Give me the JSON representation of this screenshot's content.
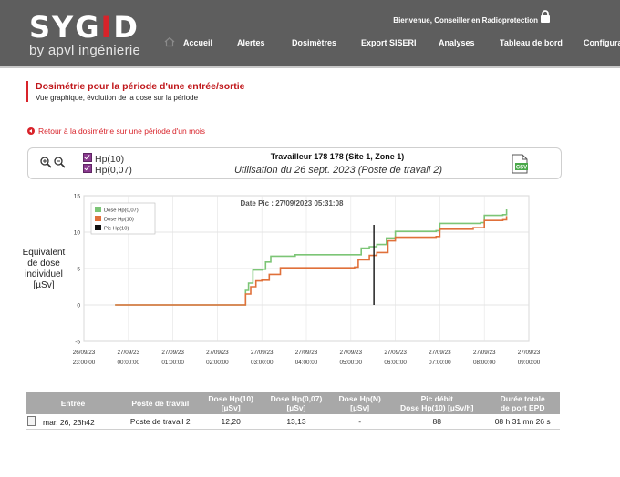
{
  "header": {
    "logo_main_left": "SYG",
    "logo_main_red": "I",
    "logo_main_right": "D",
    "logo_sub": "by apvl ingénierie",
    "welcome": "Bienvenue, Conseiller en Radioprotection",
    "nav": [
      "Accueil",
      "Alertes",
      "Dosimètres",
      "Export SISERI",
      "Analyses",
      "Tableau de bord",
      "Configurati"
    ]
  },
  "page": {
    "title": "Dosimétrie pour la période d'une entrée/sortie",
    "subtitle": "Vue graphique, évolution de la dose sur la période",
    "back_link": "Retour à la dosimétrie sur une période d'un mois"
  },
  "toolbar": {
    "legend": [
      "Hp(10)",
      "Hp(0,07)"
    ],
    "worker": "Travailleur 178 178 (Site 1, Zone 1)",
    "usage": "Utilisation du 26 sept. 2023 (Poste de travail 2)",
    "csv_label": "CSV"
  },
  "chart_data": {
    "type": "line",
    "title": "Date Pic : 27/09/2023 05:31:08",
    "ylabel": [
      "Equivalent",
      "de dose",
      "individuel",
      "[µSv]"
    ],
    "ylim": [
      -5,
      15
    ],
    "yticks": [
      "15",
      "10",
      "5",
      "0",
      "-5"
    ],
    "xticks": [
      [
        "26/09/23",
        "23:00:00"
      ],
      [
        "27/09/23",
        "00:00:00"
      ],
      [
        "27/09/23",
        "01:00:00"
      ],
      [
        "27/09/23",
        "02:00:00"
      ],
      [
        "27/09/23",
        "03:00:00"
      ],
      [
        "27/09/23",
        "04:00:00"
      ],
      [
        "27/09/23",
        "05:00:00"
      ],
      [
        "27/09/23",
        "06:00:00"
      ],
      [
        "27/09/23",
        "07:00:00"
      ],
      [
        "27/09/23",
        "08:00:00"
      ],
      [
        "27/09/23",
        "09:00:00"
      ]
    ],
    "grid": true,
    "legend_position": "top-left",
    "series": [
      {
        "name": "Dose Hp(0,07)",
        "color": "#7cc576",
        "points": [
          [
            "2023-09-26 23:42",
            0
          ],
          [
            "2023-09-27 02:35",
            0
          ],
          [
            "2023-09-27 02:38",
            2
          ],
          [
            "2023-09-27 02:42",
            3
          ],
          [
            "2023-09-27 02:48",
            4.8
          ],
          [
            "2023-09-27 03:00",
            4.9
          ],
          [
            "2023-09-27 03:05",
            5.9
          ],
          [
            "2023-09-27 03:12",
            6.7
          ],
          [
            "2023-09-27 03:45",
            6.9
          ],
          [
            "2023-09-27 05:10",
            6.9
          ],
          [
            "2023-09-27 05:14",
            7.8
          ],
          [
            "2023-09-27 05:25",
            8.0
          ],
          [
            "2023-09-27 05:35",
            8.3
          ],
          [
            "2023-09-27 05:48",
            9.2
          ],
          [
            "2023-09-27 06:00",
            10.1
          ],
          [
            "2023-09-27 06:55",
            10.2
          ],
          [
            "2023-09-27 07:00",
            11.2
          ],
          [
            "2023-09-27 07:55",
            11.3
          ],
          [
            "2023-09-27 08:00",
            12.3
          ],
          [
            "2023-09-27 08:25",
            12.4
          ],
          [
            "2023-09-27 08:30",
            13.13
          ]
        ]
      },
      {
        "name": "Dose Hp(10)",
        "color": "#e0703a",
        "points": [
          [
            "2023-09-26 23:42",
            0
          ],
          [
            "2023-09-27 02:35",
            0
          ],
          [
            "2023-09-27 02:38",
            1.5
          ],
          [
            "2023-09-27 02:45",
            2.5
          ],
          [
            "2023-09-27 02:52",
            3.3
          ],
          [
            "2023-09-27 03:00",
            3.4
          ],
          [
            "2023-09-27 03:10",
            4.2
          ],
          [
            "2023-09-27 03:25",
            5.1
          ],
          [
            "2023-09-27 05:05",
            5.2
          ],
          [
            "2023-09-27 05:10",
            6.2
          ],
          [
            "2023-09-27 05:25",
            6.8
          ],
          [
            "2023-09-27 05:35",
            7.2
          ],
          [
            "2023-09-27 05:50",
            8.8
          ],
          [
            "2023-09-27 06:00",
            9.3
          ],
          [
            "2023-09-27 06:55",
            9.4
          ],
          [
            "2023-09-27 07:00",
            10.4
          ],
          [
            "2023-09-27 07:45",
            10.6
          ],
          [
            "2023-09-27 08:00",
            11.6
          ],
          [
            "2023-09-27 08:25",
            11.7
          ],
          [
            "2023-09-27 08:30",
            12.2
          ]
        ]
      }
    ],
    "peak": {
      "name": "Pic Hp(10)",
      "x": "2023-09-27 05:31:08",
      "color": "#111111"
    }
  },
  "table": {
    "headers": [
      [
        "Entrée"
      ],
      [
        "Poste de travail"
      ],
      [
        "Dose Hp(10)",
        "[µSv]"
      ],
      [
        "Dose Hp(0,07)",
        "[µSv]"
      ],
      [
        "Dose Hp(N)",
        "[µSv]"
      ],
      [
        "Pic débit",
        "Dose Hp(10) [µSv/h]"
      ],
      [
        "Durée totale",
        "de port EPD"
      ]
    ],
    "rows": [
      [
        "mar. 26, 23h42",
        "Poste de travail 2",
        "12,20",
        "13,13",
        "-",
        "88",
        "08 h 31 mn 26 s"
      ]
    ]
  }
}
